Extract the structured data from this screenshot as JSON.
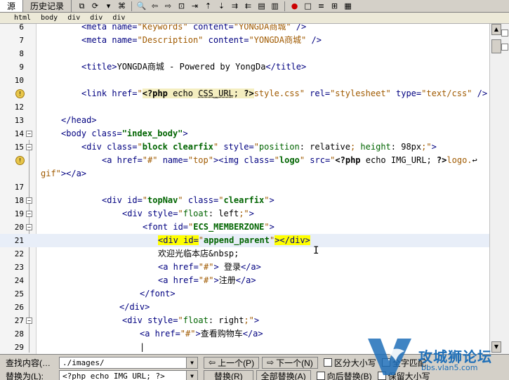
{
  "tabs": [
    {
      "label": "源",
      "active": true
    },
    {
      "label": "历史记录",
      "active": false
    }
  ],
  "breadcrumb": [
    "html",
    "body",
    "div",
    "div",
    "div"
  ],
  "editor": {
    "lines": [
      {
        "num": "6"
      },
      {
        "num": "7"
      },
      {
        "num": "8"
      },
      {
        "num": "9"
      },
      {
        "num": "10"
      },
      {
        "num": "11"
      },
      {
        "num": "12"
      },
      {
        "num": "13"
      },
      {
        "num": "14"
      },
      {
        "num": "15"
      },
      {
        "num": "16"
      },
      {
        "num": ""
      },
      {
        "num": "17"
      },
      {
        "num": "18"
      },
      {
        "num": "19"
      },
      {
        "num": "20"
      },
      {
        "num": "21"
      },
      {
        "num": "22"
      },
      {
        "num": "23"
      },
      {
        "num": "24"
      },
      {
        "num": "25"
      },
      {
        "num": "26"
      },
      {
        "num": "27"
      },
      {
        "num": "28"
      },
      {
        "num": "29"
      }
    ],
    "code": {
      "l6": [
        "<meta name=",
        "\"Keywords\"",
        " content=",
        "\"YONGDA商城\"",
        " />"
      ],
      "l7": [
        "<meta name=",
        "\"Description\"",
        " content=",
        "\"YONGDA商城\"",
        " />"
      ],
      "l9_tag1": "<title>",
      "l9_text": "YONGDA商城 - Powered by YongDa",
      "l9_tag2": "</title>",
      "l11": {
        "open": "<link href=",
        "q1": "\"",
        "php_open": "<?php",
        "echo": " echo ",
        "var": "CSS_URL",
        "semi": ";",
        "php_close": " ?>",
        "rest": "style.css\"",
        "rel_attr": " rel=",
        "rel_val": "\"stylesheet\"",
        "type_attr": " type=",
        "type_val": "\"text/css\"",
        "end": " />"
      },
      "l13": "</head>",
      "l14": {
        "open": "<body class=",
        "val": "\"index_body\"",
        "end": ">"
      },
      "l15": {
        "open": "<div class=",
        "q1": "\"",
        "cls": "block clearfix",
        "q2": "\"",
        "style_attr": " style=",
        "style_q": "\"",
        "p1": "position",
        "v1": ": relative",
        "sc1": "; ",
        "p2": "height",
        "v2": ": 98px",
        "sc2": ";\"",
        "end": ">"
      },
      "l16": {
        "open": "<a href=",
        "href": "\"#\"",
        "name_attr": " name=",
        "name_val": "\"top\"",
        "img": "><img class=",
        "q1": "\"",
        "cls": "logo",
        "q2": "\"",
        "src_attr": " src=",
        "src_q": "\"",
        "php_open": "<?php",
        "echo": " echo ",
        "var": "IMG_URL",
        "semi": ";",
        "php_close": " ?>",
        "rest": "logo.",
        "wrap": "↩"
      },
      "l16b": {
        "rest": "gif\"",
        "end": "></a>"
      },
      "l18": {
        "open": "<div id=",
        "q1": "\"",
        "id": "topNav",
        "q2": "\"",
        "cls_attr": " class=",
        "cq1": "\"",
        "cls": "clearfix",
        "cq2": "\"",
        "end": ">"
      },
      "l19": {
        "open": "<div style=",
        "q1": "\"",
        "p": "float",
        "v": ": left",
        "sc": ";\"",
        "end": ">"
      },
      "l20": {
        "open": "<font id=",
        "q1": "\"",
        "id": "ECS_MEMBERZONE",
        "q2": "\"",
        "end": ">"
      },
      "l21": {
        "open": "<div id=",
        "q1": "\"",
        "id": "append_parent",
        "q2": "\"",
        "gt": ">",
        "close": "</div>"
      },
      "l22": {
        "text": "欢迎光临本店",
        "ent": "&nbsp;"
      },
      "l23": {
        "open": "<a href=",
        "href": "\"#\"",
        "gt": ">",
        "text": " 登录",
        "close": "</a>"
      },
      "l24": {
        "open": "<a href=",
        "href": "\"#\"",
        "gt": ">",
        "text": "注册",
        "close": "</a>"
      },
      "l25": "</font>",
      "l26": "</div>",
      "l27": {
        "open": "<div style=",
        "q1": "\"",
        "p": "float",
        "v": ": right",
        "sc": ";\"",
        "end": ">"
      },
      "l28": {
        "open": "<a href=",
        "href": "\"#\"",
        "gt": ">",
        "text": "查看购物车",
        "close": "</a>"
      },
      "l29": "|"
    }
  },
  "find": {
    "find_label": "查找内容(…",
    "find_value": "./images/",
    "replace_label": "替换为(L):",
    "replace_value": "<?php echo IMG_URL; ?>",
    "prev_label": "上一个(P)",
    "next_label": "下一个(N)",
    "replace_btn": "替换(R)",
    "replace_all_btn": "全部替换(A)",
    "case_label": "区分大小写",
    "whole_label": "全字匹配",
    "reverse_label": "向后替换(B)",
    "keep_case_label": "保留大小写"
  },
  "watermark": {
    "text": "攻城狮论坛",
    "url": "bbs.vlan5.com"
  },
  "colors": {
    "tag": "#000080",
    "string": "#a05a00",
    "bold_value": "#006400",
    "highlight": "#ffff00",
    "php_bg": "#f4eec0",
    "watermark": "#1e6fb8"
  }
}
